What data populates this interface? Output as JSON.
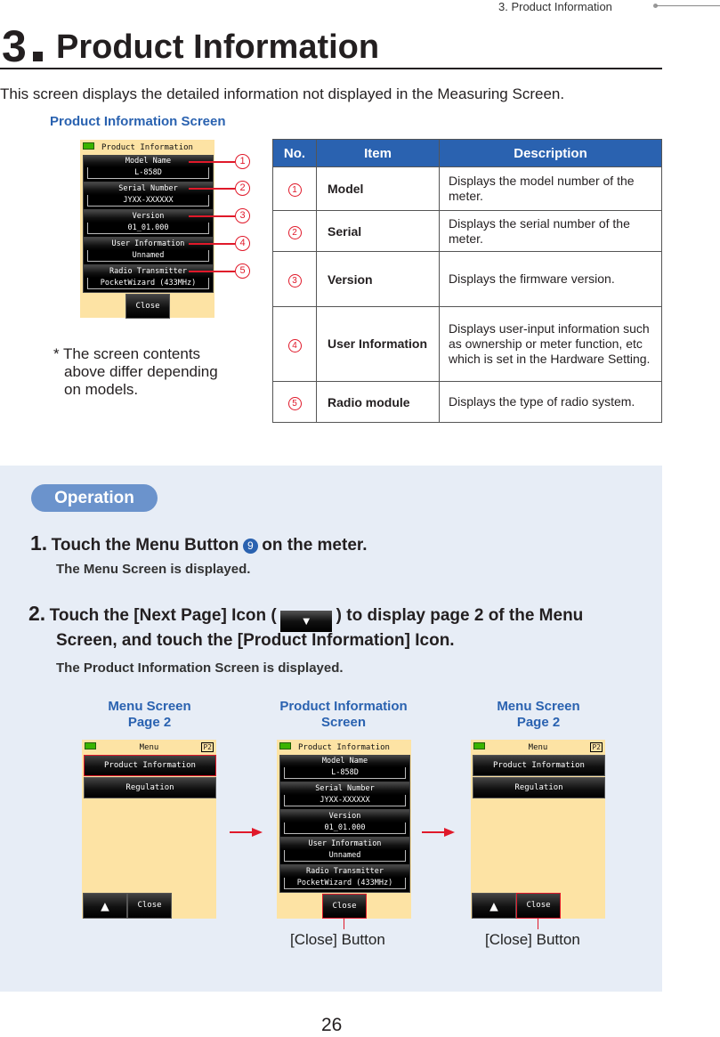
{
  "running_header": "3.  Product Information",
  "title": {
    "number": "3",
    "text": "Product Information"
  },
  "intro": "This screen displays the detailed information not displayed in the Measuring Screen.",
  "screen_label": "Product Information Screen",
  "meter_screen": {
    "title": "Product Information",
    "fields": [
      {
        "label": "Model Name",
        "value": "L-858D",
        "callout": "1"
      },
      {
        "label": "Serial Number",
        "value": "JYXX-XXXXXX",
        "callout": "2"
      },
      {
        "label": "Version",
        "value": "01_01.000",
        "callout": "3"
      },
      {
        "label": "User Information",
        "value": "Unnamed",
        "callout": "4"
      },
      {
        "label": "Radio Transmitter",
        "value": "PocketWizard (433MHz)",
        "callout": "5"
      }
    ],
    "close_label": "Close"
  },
  "note": [
    "* The screen contents",
    "above differ depending",
    "on models."
  ],
  "table": {
    "headers": [
      "No.",
      "Item",
      "Description"
    ],
    "rows": [
      {
        "no": "1",
        "item": "Model",
        "desc": "Displays the model number of the meter."
      },
      {
        "no": "2",
        "item": "Serial",
        "desc": "Displays the serial number of the meter."
      },
      {
        "no": "3",
        "item": "Version",
        "desc": "Displays the firmware version."
      },
      {
        "no": "4",
        "item": "User Information",
        "desc": "Displays user-input information such as ownership or meter function, etc which is set in the Hardware Setting."
      },
      {
        "no": "5",
        "item": "Radio module",
        "desc": "Displays the type of radio system."
      }
    ]
  },
  "operation": {
    "badge": "Operation",
    "step1": {
      "num": "1.",
      "text_before": "Touch the Menu Button",
      "button_num": "9",
      "text_after": "on the meter.",
      "sub": "The Menu Screen is displayed."
    },
    "step2": {
      "num": "2.",
      "text_before": "Touch the [Next Page] Icon (",
      "icon": "▼",
      "text_after": ") to display page 2 of the Menu",
      "line2": "Screen, and touch the [Product Information] Icon.",
      "sub": "The Product Information Screen is displayed."
    },
    "captions": [
      "Menu Screen",
      "Page 2",
      "Product Information",
      "Screen",
      "Menu Screen",
      "Page 2"
    ],
    "menu_screen": {
      "title": "Menu",
      "page": "P2",
      "items": [
        "Product Information",
        "Regulation"
      ],
      "up_icon": "▲",
      "close_label": "Close"
    },
    "close_button_caption": "[Close] Button"
  },
  "page_number": "26"
}
